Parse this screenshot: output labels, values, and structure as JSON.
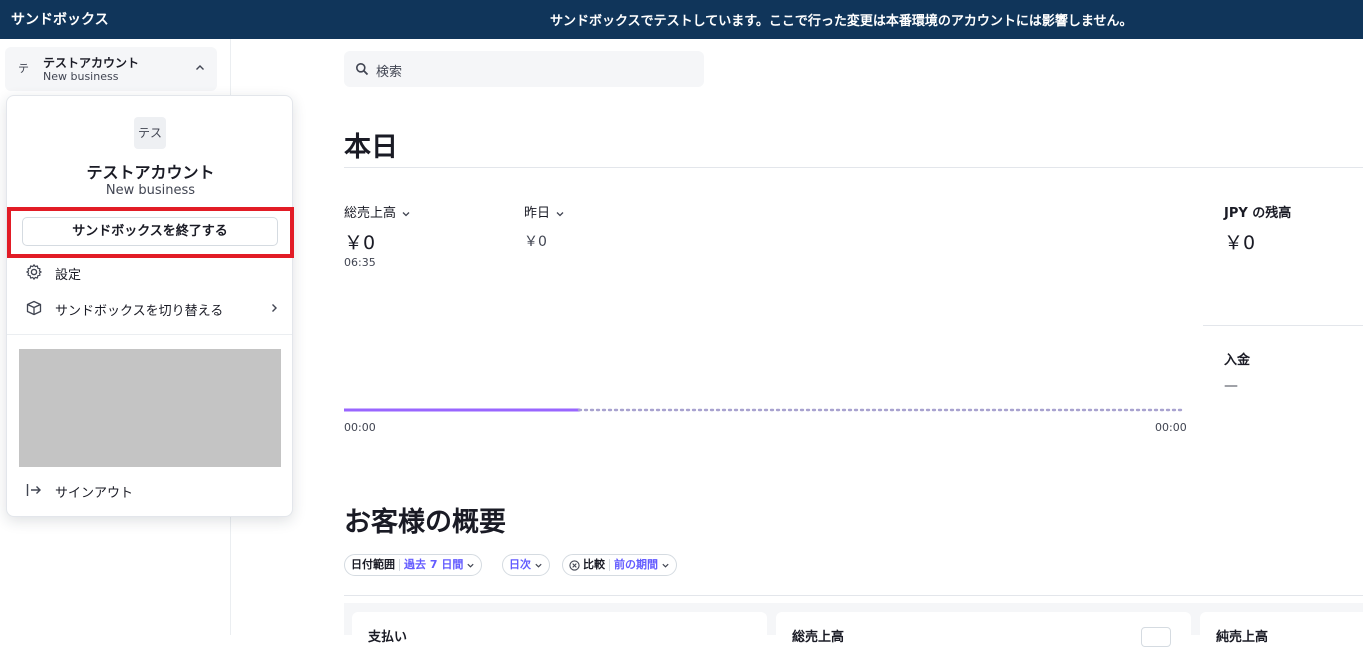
{
  "topbar": {
    "brand": "サンドボックス",
    "notice": "サンドボックスでテストしています。ここで行った変更は本番環境のアカウントには影響しません。"
  },
  "account_switcher": {
    "initial": "テ",
    "name": "テストアカウント",
    "subtitle": "New business"
  },
  "account_menu": {
    "avatar_text": "テス",
    "name": "テストアカウント",
    "subtitle": "New business",
    "exit_sandbox_label": "サンドボックスを終了する",
    "settings_label": "設定",
    "switch_sandbox_label": "サンドボックスを切り替える",
    "sign_out_label": "サインアウト",
    "highlight_color": "#e21c26"
  },
  "search": {
    "placeholder": "検索"
  },
  "today": {
    "heading": "本日",
    "gross_volume_label": "総売上高",
    "gross_volume_value": "￥0",
    "gross_volume_time": "06:35",
    "yesterday_label": "昨日",
    "yesterday_value": "￥0",
    "balance_label": "JPY の残高",
    "balance_value": "￥0",
    "payouts_label": "入金",
    "payouts_value": "—",
    "chart_axis_start": "00:00",
    "chart_axis_end": "00:00",
    "chart_progress": 0.28,
    "chart_color": "#9966ff"
  },
  "customers": {
    "heading": "お客様の概要",
    "filters": [
      {
        "key": "日付範囲",
        "value": "過去 7 日間"
      },
      {
        "key": "",
        "value": "日次"
      },
      {
        "key": "比較",
        "value": "前の期間"
      }
    ],
    "cards": [
      "支払い",
      "総売上高",
      "純売上高"
    ]
  },
  "colors": {
    "topbar_bg": "#10355a",
    "accent": "#635bff"
  }
}
